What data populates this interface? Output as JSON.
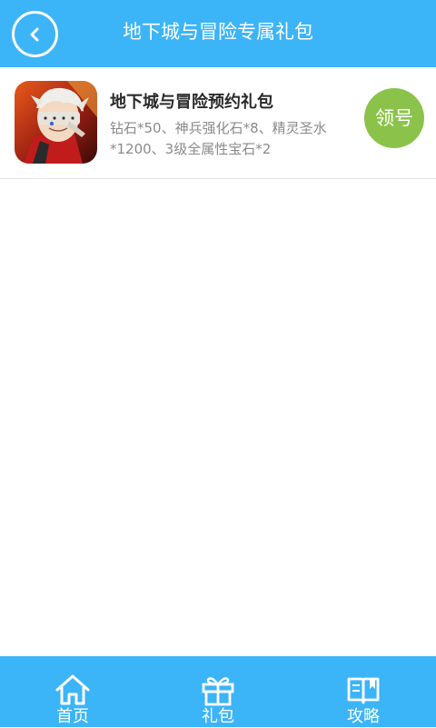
{
  "header": {
    "title": "地下城与冒险专属礼包",
    "back_icon": "back-arrow-icon"
  },
  "gift": {
    "title": "地下城与冒险预约礼包",
    "description": "钻石*50、神兵强化石*8、精灵圣水*1200、3级全属性宝石*2",
    "claim_label": "领号",
    "claim_color": "#8bc34a"
  },
  "bottom_nav": {
    "items": [
      {
        "label": "首页",
        "icon": "home-icon"
      },
      {
        "label": "礼包",
        "icon": "gift-icon"
      },
      {
        "label": "攻略",
        "icon": "book-icon"
      }
    ]
  },
  "colors": {
    "accent": "#3cb4f8",
    "claim": "#8bc34a"
  }
}
